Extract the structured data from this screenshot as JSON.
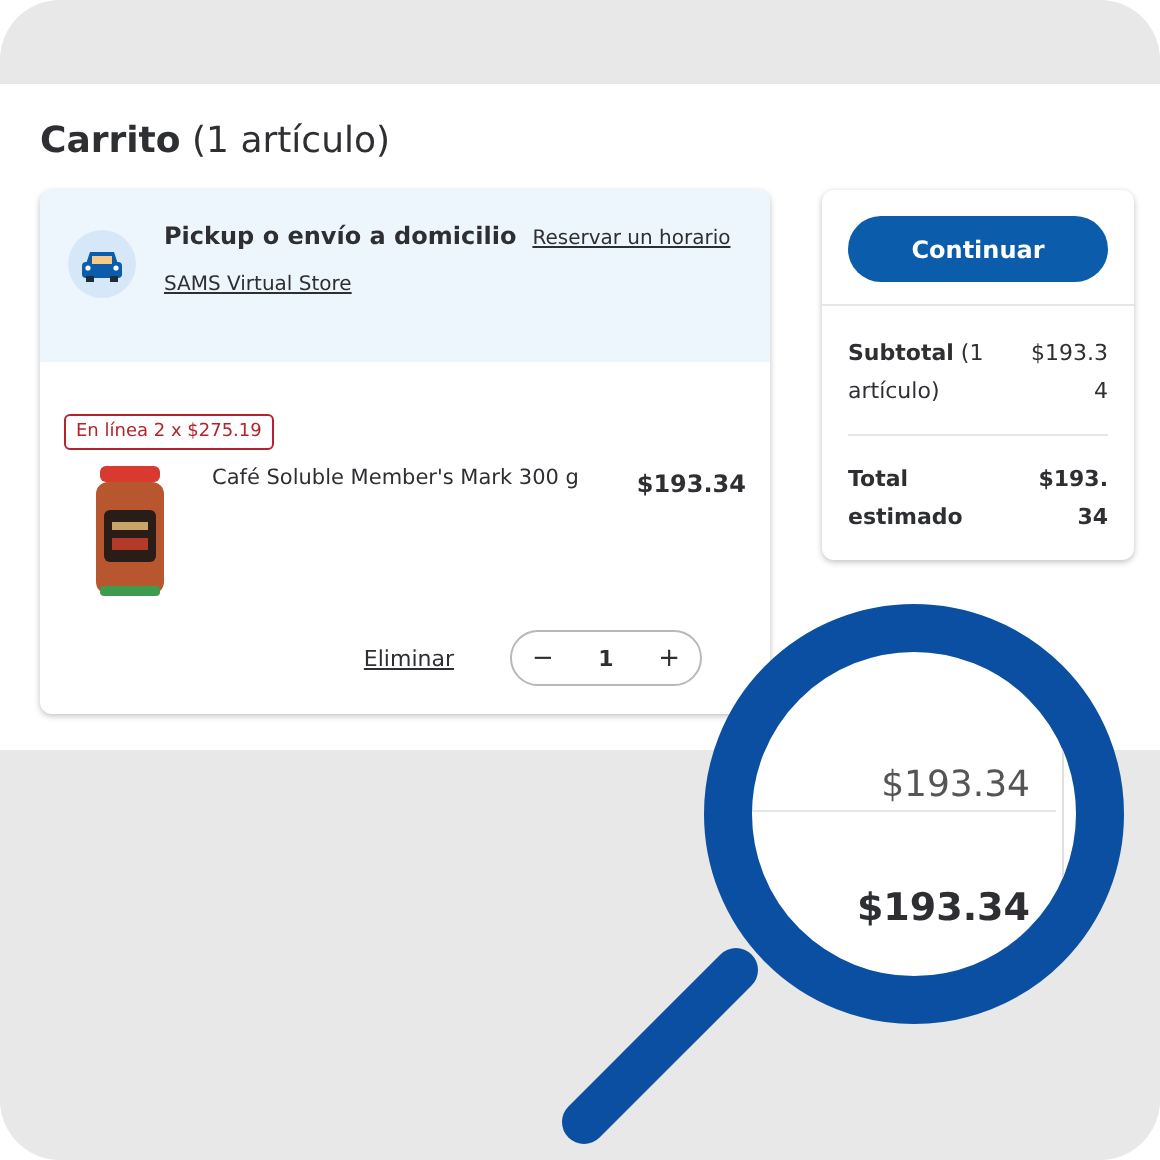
{
  "page": {
    "title": "Carrito",
    "count": "(1 artículo)"
  },
  "fulfillment": {
    "title": "Pickup o envío a domicilio",
    "link": "Reservar un horario",
    "store": "SAMS Virtual Store"
  },
  "items": [
    {
      "badge": "En línea 2 x $275.19",
      "name": "Café Soluble Member's Mark 300 g",
      "price": "$193.34",
      "remove": "Eliminar",
      "decrease": "−",
      "quantity": "1",
      "increase": "+"
    }
  ],
  "summary": {
    "button": "Continuar",
    "rows": [
      {
        "kind": "subtotal",
        "label": "**Subtotal** (1 artículo)",
        "value": "$193.34"
      },
      {
        "kind": "total",
        "label": "Total estimado",
        "value": "$193.34"
      }
    ]
  },
  "magnifier": {
    "rows": [
      {
        "kind": "subtotal",
        "value": "$193.34"
      },
      {
        "kind": "total",
        "value": "$193.34"
      }
    ]
  }
}
